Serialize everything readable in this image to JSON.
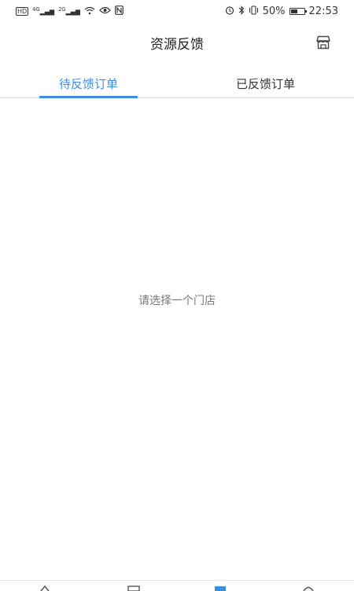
{
  "status_bar": {
    "left_icons": [
      "hd-icon",
      "signal-4g-icon",
      "signal-2g-icon",
      "wifi-icon",
      "eye-icon",
      "nfc-icon"
    ],
    "signal_4g_label": "4G",
    "signal_2g_label": "2G",
    "right_icons": [
      "alarm-icon",
      "bluetooth-icon",
      "vibrate-icon",
      "battery-icon"
    ],
    "battery_percent": "50%",
    "battery_level": 0.5,
    "time": "22:53"
  },
  "header": {
    "title": "资源反馈",
    "store_icon": "store-icon"
  },
  "tabs": [
    {
      "label": "待反馈订单",
      "active": true
    },
    {
      "label": "已反馈订单",
      "active": false
    }
  ],
  "main": {
    "empty_message": "请选择一个门店"
  },
  "colors": {
    "accent": "#3d8ee0",
    "text": "#222222",
    "muted": "#777777",
    "divider": "#d8d8d8"
  }
}
